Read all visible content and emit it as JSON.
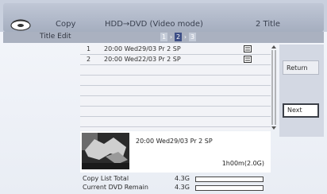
{
  "header": {
    "mode": "Copy",
    "center": "HDD→DVD (Video mode)",
    "count": "2 Title"
  },
  "subheader": {
    "label": "Title Edit",
    "steps": [
      "1",
      "2",
      "3"
    ],
    "current_step": 2
  },
  "titles": [
    {
      "num": "1",
      "text": "20:00  Wed29/03  Pr 2   SP"
    },
    {
      "num": "2",
      "text": "20:00  Wed22/03  Pr 2   SP"
    }
  ],
  "buttons": {
    "return_label": "Return",
    "next_label": "Next"
  },
  "preview": {
    "info": "20:00     Wed29/03     Pr 2     SP",
    "duration": "1h00m(2.0G)"
  },
  "footer": {
    "total_label": "Copy List Total",
    "total_value": "4.3G",
    "total_fill": 0,
    "remain_label": "Current DVD Remain",
    "remain_value": "4.3G",
    "remain_fill": 0
  }
}
